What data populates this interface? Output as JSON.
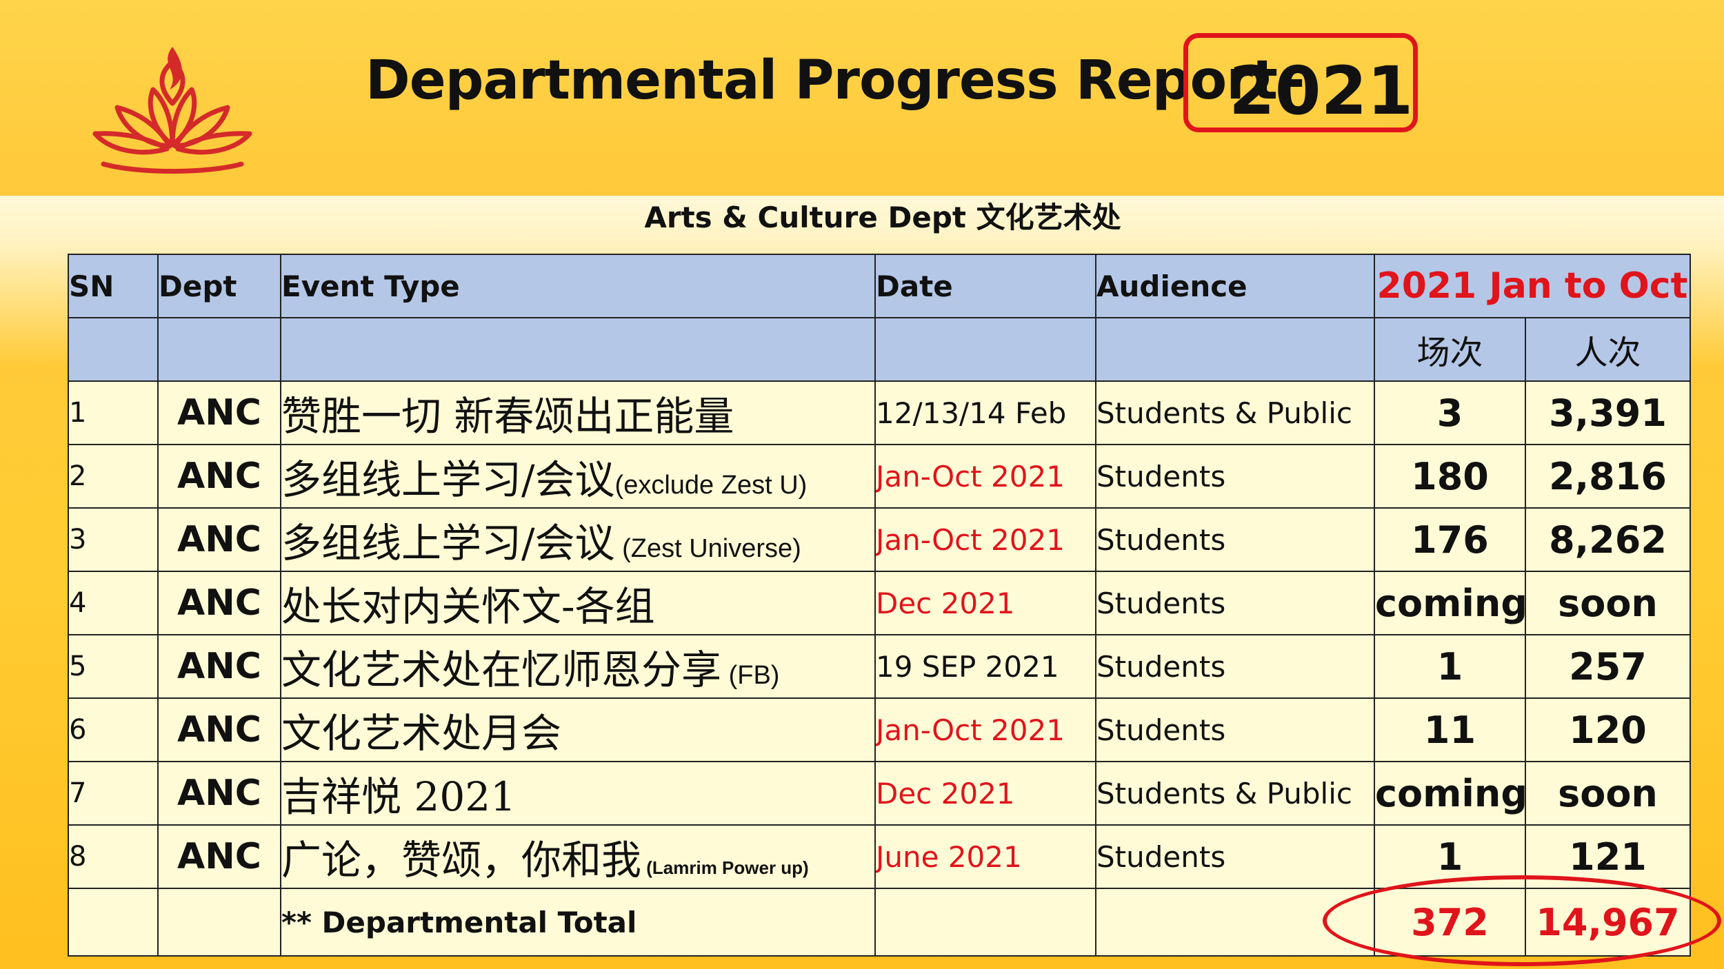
{
  "title": "Departmental Progress Report",
  "title_dash": "-",
  "year": "2021",
  "subtitle": "Arts & Culture Dept 文化艺术处",
  "icons": {
    "logo": "lotus-flame-logo"
  },
  "colors": {
    "accent_red": "#e0141b",
    "header_blue": "#b4c7e7",
    "row_fill": "#fffbd6",
    "background": "#ffcc33"
  },
  "table": {
    "headers": {
      "sn": "SN",
      "dept": "Dept",
      "event": "Event Type",
      "date": "Date",
      "audience": "Audience",
      "range": "2021 Jan to Oct",
      "sessions": "场次",
      "attendance": "人次"
    },
    "rows": [
      {
        "sn": "1",
        "dept": "ANC",
        "event": "赞胜一切 新春颂出正能量",
        "note": "",
        "date": "12/13/14 Feb",
        "date_red": false,
        "audience": "Students & Public",
        "sessions": "3",
        "attendance": "3,391"
      },
      {
        "sn": "2",
        "dept": "ANC",
        "event": "多组线上学习/会议",
        "note": "(exclude Zest U)",
        "date": "Jan-Oct 2021",
        "date_red": true,
        "audience": "Students",
        "sessions": "180",
        "attendance": "2,816"
      },
      {
        "sn": "3",
        "dept": "ANC",
        "event": "多组线上学习/会议",
        "note": " (Zest Universe)",
        "date": "Jan-Oct 2021",
        "date_red": true,
        "audience": "Students",
        "sessions": "176",
        "attendance": "8,262"
      },
      {
        "sn": "4",
        "dept": "ANC",
        "event": "处长对内关怀文-各组",
        "note": "",
        "date": "Dec 2021",
        "date_red": true,
        "audience": "Students",
        "sessions": "coming",
        "attendance": "soon"
      },
      {
        "sn": "5",
        "dept": "ANC",
        "event": "文化艺术处在忆师恩分享",
        "note": " (FB)",
        "date": "19 SEP 2021",
        "date_red": false,
        "audience": "Students",
        "sessions": "1",
        "attendance": "257"
      },
      {
        "sn": "6",
        "dept": "ANC",
        "event": "文化艺术处月会",
        "note": "",
        "date": "Jan-Oct 2021",
        "date_red": true,
        "audience": "Students",
        "sessions": "11",
        "attendance": "120"
      },
      {
        "sn": "7",
        "dept": "ANC",
        "event": "吉祥悦 2021",
        "note": "",
        "date": "Dec 2021",
        "date_red": true,
        "audience": "Students & Public",
        "sessions": "coming",
        "attendance": "soon"
      },
      {
        "sn": "8",
        "dept": "ANC",
        "event": "广论，赞颂，你和我",
        "note": " (Lamrim Power up)",
        "note_small": true,
        "date": "June 2021",
        "date_red": true,
        "audience": "Students",
        "sessions": "1",
        "attendance": "121"
      }
    ],
    "total": {
      "label": "** Departmental Total",
      "sessions": "372",
      "attendance": "14,967"
    }
  }
}
